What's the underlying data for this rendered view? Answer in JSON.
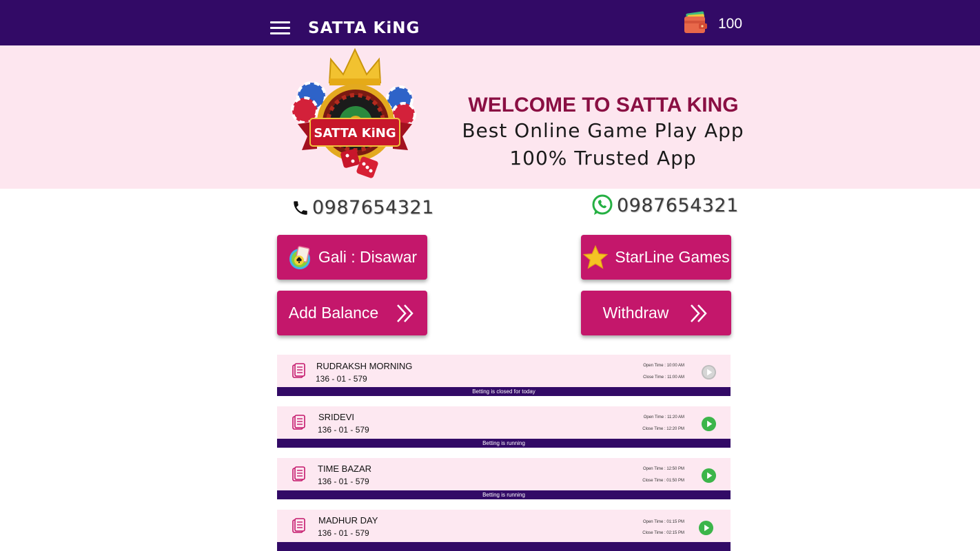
{
  "header": {
    "app_title": "SATTA KiNG",
    "wallet_balance": "100",
    "menu_icon": "hamburger-menu-icon",
    "wallet_icon": "wallet-icon"
  },
  "banner": {
    "welcome": "WELCOME TO SATTA KING",
    "tagline1": "Best Online Game Play App",
    "tagline2": "100% Trusted App",
    "logo_text": "SATTA KiNG"
  },
  "contacts": {
    "phone": "0987654321",
    "whatsapp": "0987654321"
  },
  "buttons": {
    "gali_disawar": "Gali : Disawar",
    "starline": "StarLine Games",
    "add_balance": "Add Balance",
    "withdraw": "Withdraw"
  },
  "games": [
    {
      "name": "RUDRAKSH MORNING",
      "result": "136 - 01 - 579",
      "open_time": "Open Time : 10:00 AM",
      "close_time": "Close Time : 11:00 AM",
      "status": "Betting is closed for today",
      "active": false
    },
    {
      "name": "SRIDEVI",
      "result": "136 - 01 - 579",
      "open_time": "Open Time : 11:20 AM",
      "close_time": "Close Time : 12:20 PM",
      "status": "Betting is running",
      "active": true
    },
    {
      "name": "TIME BAZAR",
      "result": "136 - 01 - 579",
      "open_time": "Open Time : 12:50 PM",
      "close_time": "Close Time : 01:50 PM",
      "status": "Betting is running",
      "active": true
    },
    {
      "name": "MADHUR DAY",
      "result": "136 - 01 - 579",
      "open_time": "Open Time : 01:15 PM",
      "close_time": "Close Time : 02:15 PM",
      "status": "",
      "active": true
    }
  ],
  "colors": {
    "header_bg": "#320a66",
    "banner_bg": "#fde6ef",
    "button_bg": "#c4176b",
    "card_bg": "#fde8f1",
    "play_active": "#3cb54a",
    "play_inactive": "#bdbdbd"
  }
}
